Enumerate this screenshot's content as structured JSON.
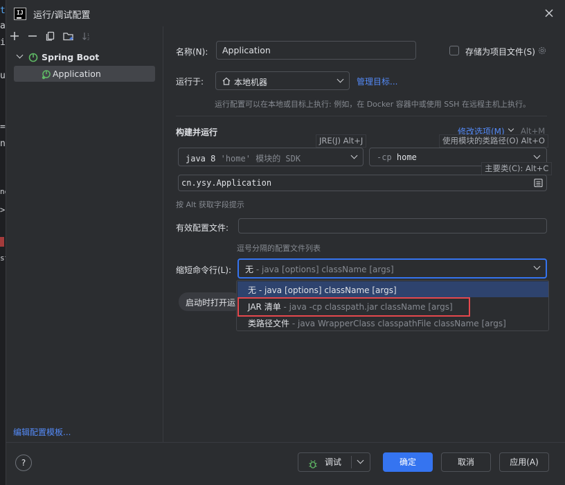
{
  "window": {
    "title": "运行/调试配置"
  },
  "toolbar": {
    "add": "+",
    "remove": "—"
  },
  "tree": {
    "group_label": "Spring Boot",
    "item_label": "Application"
  },
  "edit_templates_link": "编辑配置模板...",
  "form": {
    "name_label": "名称(N):",
    "name_value": "Application",
    "store_as_file_label": "存储为项目文件(S)",
    "run_on_label": "运行于:",
    "run_on_value": "本地机器",
    "manage_targets_link": "管理目标...",
    "run_on_hint": "运行配置可以在本地或目标上执行: 例如，在 Docker 容器中或使用 SSH 在远程主机上执行。",
    "build_run_header": "构建并运行",
    "modify_options_label": "修改选项(M)",
    "modify_options_shortcut": "Alt+M",
    "jre_tooltip": "JRE(J) Alt+J",
    "classpath_tooltip": "使用模块的类路径(O) Alt+O",
    "sdk_prefix": "java 8",
    "sdk_module": "'home'",
    "sdk_suffix": "模块的 SDK",
    "cp_flag": "-cp",
    "cp_value": "home",
    "main_class_tooltip": "主要类(C): Alt+C",
    "main_class_value": "cn.ysy.Application",
    "alt_hint": "按 Alt 获取字段提示",
    "active_profiles_label": "有效配置文件:",
    "active_profiles_value": "",
    "active_profiles_hint": "逗号分隔的配置文件列表",
    "shorten_cmd_label": "缩短命令行(L):",
    "shorten_selected_main": "无",
    "shorten_selected_desc": "- java [options] className [args]",
    "open_on_start_label": "启动时打开运"
  },
  "dropdown": {
    "options": [
      {
        "main": "无",
        "desc": "- java [options] className [args]"
      },
      {
        "main": "JAR 清单",
        "desc": "- java -cp classpath.jar className [args]"
      },
      {
        "main": "类路径文件",
        "desc": "- java WrapperClass classpathFile className [args]"
      }
    ]
  },
  "footer": {
    "help": "?",
    "debug": "调试",
    "ok": "确定",
    "cancel": "取消",
    "apply": "应用(A)"
  },
  "bg_editor_fragments": [
    "t",
    "a",
    "i",
    "u",
    "=",
    "n",
    "ng",
    ">",
    "st"
  ],
  "colors": {
    "accent": "#3574f0",
    "link": "#548af7",
    "highlight_box": "#e5484d",
    "selection": "#43454a",
    "spring_green": "#5fb865"
  }
}
